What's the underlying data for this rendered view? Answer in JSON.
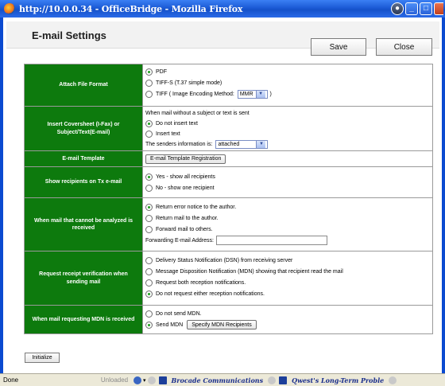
{
  "browser": {
    "title": "http://10.0.0.34 - OfficeBridge - Mozilla Firefox"
  },
  "header": {
    "title": "E-mail Settings",
    "save_label": "Save",
    "close_label": "Close"
  },
  "rows": {
    "attach": {
      "label": "Attach File Format",
      "opt1": "PDF",
      "opt2": "TIFF-S (T.37 simple mode)",
      "opt3_prefix": "TIFF ( Image Encoding Method:",
      "opt3_suffix": ")",
      "encoding_value": "MMR"
    },
    "coversheet": {
      "label": "Insert Coversheet (I-Fax) or Subject/Text(E-mail)",
      "intro": "When mail without a subject or text is sent",
      "opt1": "Do not insert text",
      "opt2": "Insert text",
      "senders_label": "The senders information is:",
      "senders_value": "attached"
    },
    "template": {
      "label": "E-mail Template",
      "button": "E-mail Template Registration"
    },
    "recipients": {
      "label": "Show recipients on Tx e-mail",
      "opt1": "Yes - show all recipients",
      "opt2": "No - show one recipient"
    },
    "unanalyzed": {
      "label": "When mail that cannot be analyzed is received",
      "opt1": "Return error notice to the author.",
      "opt2": "Return mail to the author.",
      "opt3": "Forward mail to others.",
      "forward_label": "Forwarding E-mail Address:"
    },
    "receipt": {
      "label": "Request receipt verification when sending mail",
      "opt1": "Delivery Status Notification (DSN) from receiving server",
      "opt2": "Message Disposition Notification (MDN) showing that recipient read the mail",
      "opt3": "Request both reception notifications.",
      "opt4": "Do not request either reception notifications."
    },
    "mdn": {
      "label": "When mail requesting MDN is received",
      "opt1": "Do not send MDN.",
      "opt2": "Send MDN",
      "button": "Specify MDN Recipients"
    }
  },
  "initialize_label": "Initialize",
  "status": {
    "done": "Done",
    "unloaded": "Unloaded",
    "item1": "Brocade Communications",
    "item2": "Qwest's Long-Term Proble"
  }
}
